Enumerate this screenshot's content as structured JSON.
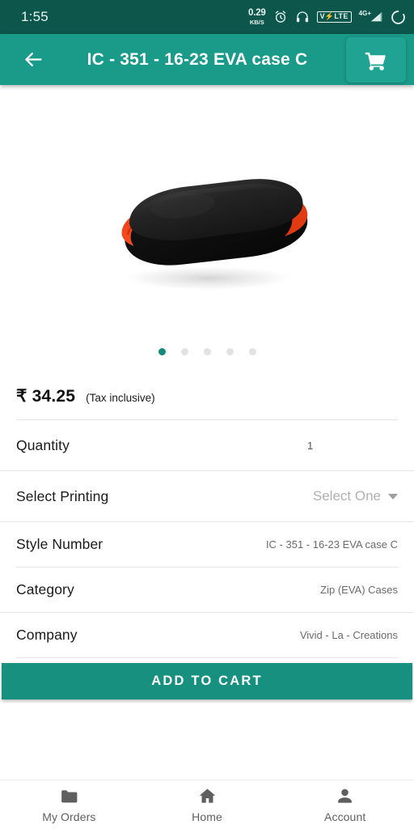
{
  "status_bar": {
    "time": "1:55",
    "network_speed_value": "0.29",
    "network_speed_unit": "KB/S",
    "alarm_icon": "alarm-clock-icon",
    "headphones_icon": "headphones-icon",
    "volte_label": "V⚡LTE",
    "signal_label": "4G+",
    "battery_icon": "battery-circle-icon",
    "background_color": "#0c564c"
  },
  "app_bar": {
    "back_icon": "arrow-left-icon",
    "title": "IC - 351 - 16-23 EVA case C",
    "cart_icon": "shopping-cart-icon",
    "background_color": "#1a9a89",
    "cart_button_color": "#21a394"
  },
  "gallery": {
    "product_alt": "black EVA zip case with orange zipper",
    "product_body_color": "#1d1d1d",
    "zipper_color": "#f4421c",
    "total_slides": 5,
    "active_slide": 1,
    "active_dot_color": "#16897a",
    "inactive_dot_color": "#e2e2e2"
  },
  "price_section": {
    "currency_symbol": "₹",
    "price": "₹ 34.25",
    "tax_note": "(Tax inclusive)"
  },
  "details": {
    "quantity": {
      "label": "Quantity",
      "value": "1"
    },
    "select_printing": {
      "label": "Select Printing",
      "value": "Select One",
      "caret_icon": "caret-down-icon"
    },
    "style_number": {
      "label": "Style Number",
      "value": "IC - 351 - 16-23 EVA case C"
    },
    "category": {
      "label": "Category",
      "value": "Zip (EVA) Cases"
    },
    "company": {
      "label": "Company",
      "value": "Vivid - La - Creations"
    }
  },
  "cta": {
    "add_to_cart_label": "ADD TO CART",
    "color": "#18907f"
  },
  "bottom_nav": {
    "items": [
      {
        "label": "My Orders",
        "icon": "folder-icon"
      },
      {
        "label": "Home",
        "icon": "home-icon"
      },
      {
        "label": "Account",
        "icon": "person-icon"
      }
    ]
  }
}
